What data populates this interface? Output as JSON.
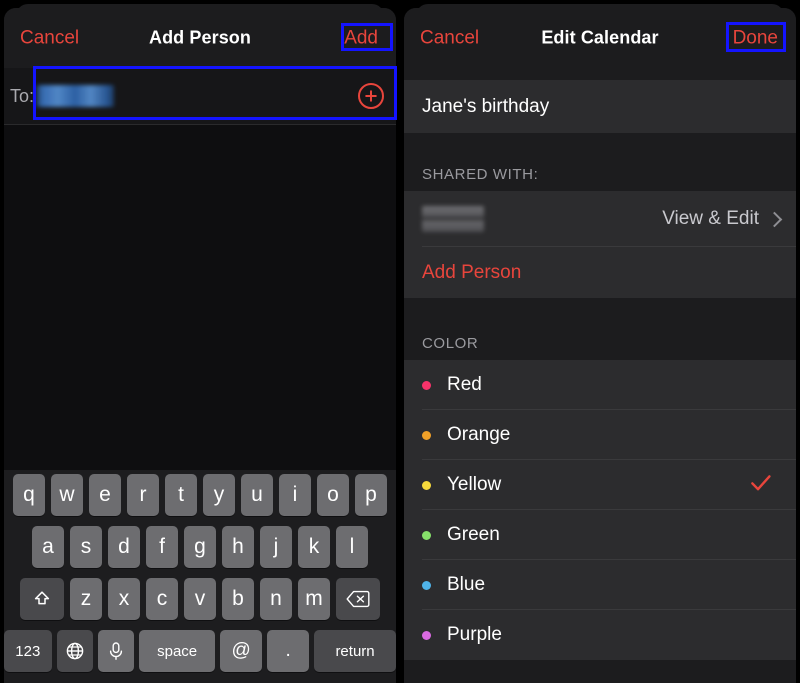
{
  "left_panel": {
    "nav": {
      "cancel_label": "Cancel",
      "title": "Add Person",
      "add_label": "Add"
    },
    "to_field": {
      "label": "To:",
      "value_redacted": "",
      "placeholder": "",
      "add_contact_icon": "plus-circle-icon"
    },
    "keyboard": {
      "row1": [
        "q",
        "w",
        "e",
        "r",
        "t",
        "y",
        "u",
        "i",
        "o",
        "p"
      ],
      "row2": [
        "a",
        "s",
        "d",
        "f",
        "g",
        "h",
        "j",
        "k",
        "l"
      ],
      "row3": [
        "z",
        "x",
        "c",
        "v",
        "b",
        "n",
        "m"
      ],
      "shift_key": "shift-icon",
      "delete_key": "delete-backspace-icon",
      "numbers_key": "123",
      "globe_key": "globe-icon",
      "mic_key": "microphone-icon",
      "space_key": "space",
      "at_key": "@",
      "period_key": ".",
      "return_key": "return"
    }
  },
  "right_panel": {
    "nav": {
      "cancel_label": "Cancel",
      "title": "Edit Calendar",
      "done_label": "Done"
    },
    "calendar_name": "Jane's birthday",
    "shared_section": {
      "header": "SHARED WITH:",
      "person_name_redacted": "",
      "permission_label": "View & Edit",
      "add_person_label": "Add Person"
    },
    "color_section": {
      "header": "COLOR",
      "selected": "Yellow",
      "options": [
        {
          "label": "Red",
          "hex": "#f7336a",
          "checked": false
        },
        {
          "label": "Orange",
          "hex": "#f0a028",
          "checked": false
        },
        {
          "label": "Yellow",
          "hex": "#f6d93c",
          "checked": true
        },
        {
          "label": "Green",
          "hex": "#86e06a",
          "checked": false
        },
        {
          "label": "Blue",
          "hex": "#4fb3e8",
          "checked": false
        },
        {
          "label": "Purple",
          "hex": "#d96ae0",
          "checked": false
        }
      ]
    }
  },
  "annotations": {
    "highlight_color": "#1414ff",
    "boxes": [
      "add-button",
      "to-field",
      "done-button"
    ]
  }
}
